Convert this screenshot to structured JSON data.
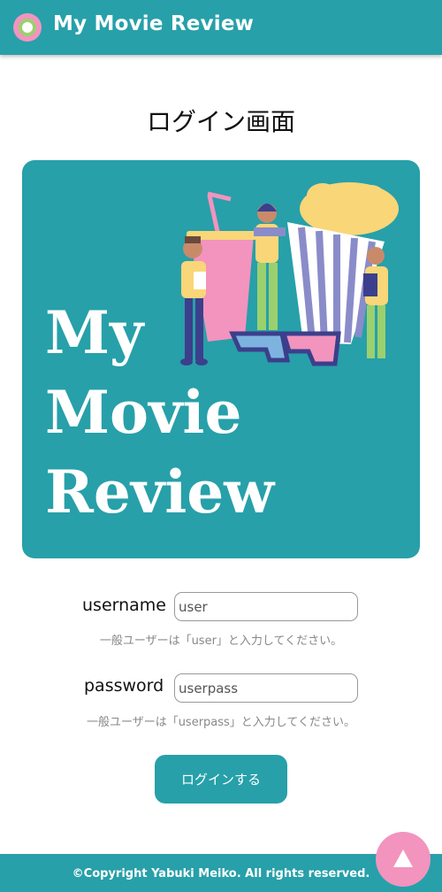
{
  "header": {
    "app_title": "My Movie Review",
    "logo_icon": "film-reel-icon"
  },
  "page_title": "ログイン画面",
  "hero": {
    "title_lines": [
      "My",
      "Movie",
      "Review"
    ]
  },
  "form": {
    "username": {
      "label": "username",
      "value": "user",
      "hint": "一般ユーザーは「user」と入力してください。"
    },
    "password": {
      "label": "password",
      "value": "userpass",
      "hint": "一般ユーザーは「userpass」と入力してください。"
    },
    "submit_label": "ログインする"
  },
  "footer": {
    "copyright": "©Copyright Yabuki Meiko. All rights reserved."
  },
  "scroll_top": {
    "icon": "arrow-up-icon"
  },
  "colors": {
    "teal": "#27a0a9",
    "pink": "#f294be",
    "yellow": "#f9d678",
    "purple": "#3c3f8c"
  }
}
